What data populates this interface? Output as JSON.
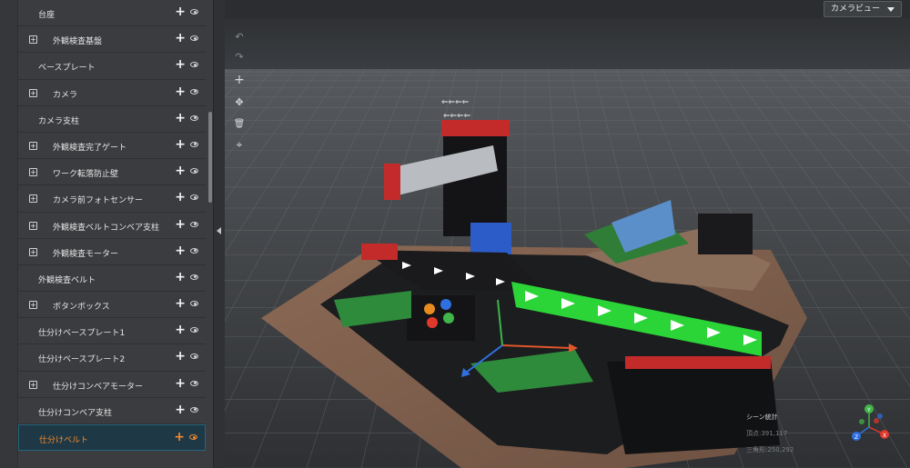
{
  "camera_menu": {
    "label": "カメラビュー"
  },
  "tree": {
    "items": [
      {
        "label": "台座",
        "expandable": false,
        "indent": 0
      },
      {
        "label": "外観検査基盤",
        "expandable": true,
        "indent": 1
      },
      {
        "label": "ベースプレート",
        "expandable": false,
        "indent": 0
      },
      {
        "label": "カメラ",
        "expandable": true,
        "indent": 1
      },
      {
        "label": "カメラ支柱",
        "expandable": false,
        "indent": 0
      },
      {
        "label": "外観検査完了ゲート",
        "expandable": true,
        "indent": 1
      },
      {
        "label": "ワーク転落防止壁",
        "expandable": true,
        "indent": 1
      },
      {
        "label": "カメラ前フォトセンサー",
        "expandable": true,
        "indent": 1
      },
      {
        "label": "外観検査ベルトコンベア支柱",
        "expandable": true,
        "indent": 1
      },
      {
        "label": "外観検査モーター",
        "expandable": true,
        "indent": 1
      },
      {
        "label": "外観検査ベルト",
        "expandable": false,
        "indent": 0
      },
      {
        "label": "ボタンボックス",
        "expandable": true,
        "indent": 1
      },
      {
        "label": "仕分けベースプレート1",
        "expandable": false,
        "indent": 0
      },
      {
        "label": "仕分けベースプレート2",
        "expandable": false,
        "indent": 0
      },
      {
        "label": "仕分けコンベアモーター",
        "expandable": true,
        "indent": 1
      },
      {
        "label": "仕分けコンベア支柱",
        "expandable": false,
        "indent": 0
      },
      {
        "label": "仕分けベルト",
        "expandable": false,
        "indent": 0,
        "selected": true
      }
    ],
    "expand_symbol": "+",
    "add_symbol": "+"
  },
  "toolbar": {
    "undo": "↶",
    "redo": "↷",
    "add": "+",
    "move": "✥",
    "delete": "🗑",
    "focus": "⌖"
  },
  "stats": {
    "title": "シーン統計",
    "vertices": "頂点:391,117",
    "triangles": "三角形:250,292"
  },
  "gizmo": {
    "x_label": "X",
    "y_label": "Y",
    "z_label": "Z",
    "x_color": "#e0382b",
    "y_color": "#3fb54a",
    "z_color": "#2f6fe0"
  },
  "colors": {
    "selected_text": "#f28a2e",
    "selected_bg": "#1e3845"
  }
}
